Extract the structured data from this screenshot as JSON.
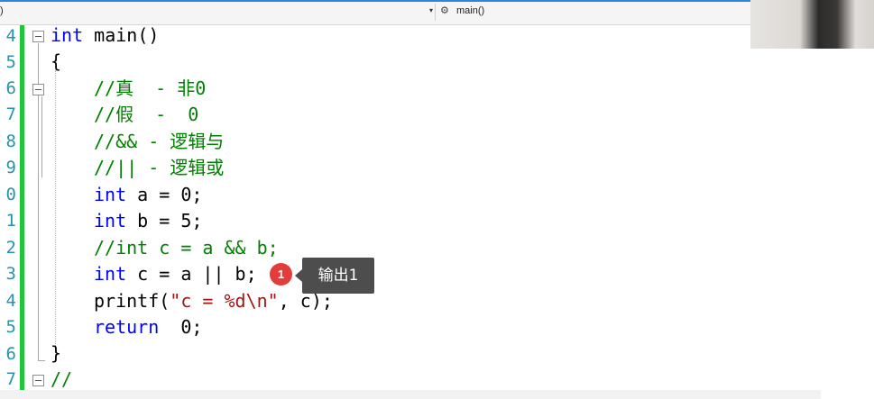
{
  "navbar": {
    "left_text": ")",
    "right_text": "main()",
    "dropdown_arrow": "▾",
    "function_icon": "⚙"
  },
  "line_numbers": [
    "4",
    "5",
    "6",
    "7",
    "8",
    "9",
    "0",
    "1",
    "2",
    "3",
    "4",
    "5",
    "6",
    "7"
  ],
  "code": {
    "l4_kw": "int",
    "l4_rest": " main()",
    "l5": "{",
    "l6": "//真  - 非0",
    "l7": "//假  -  0",
    "l8": "//&& - 逻辑与",
    "l9": "//|| - 逻辑或",
    "l10_kw": "int",
    "l10_rest": " a = 0;",
    "l11_kw": "int",
    "l11_rest": " b = 5;",
    "l12": "//int c = a && b;",
    "l13_kw": "int",
    "l13_rest": " c = a || b;",
    "l14_a": "printf(",
    "l14_str": "\"c = %d\\n\"",
    "l14_b": ", c);",
    "l15_kw": "return",
    "l15_rest": "  0;",
    "l16": "}",
    "l17": "//"
  },
  "annotation": {
    "badge_number": "1",
    "tooltip_text": "输出1"
  }
}
